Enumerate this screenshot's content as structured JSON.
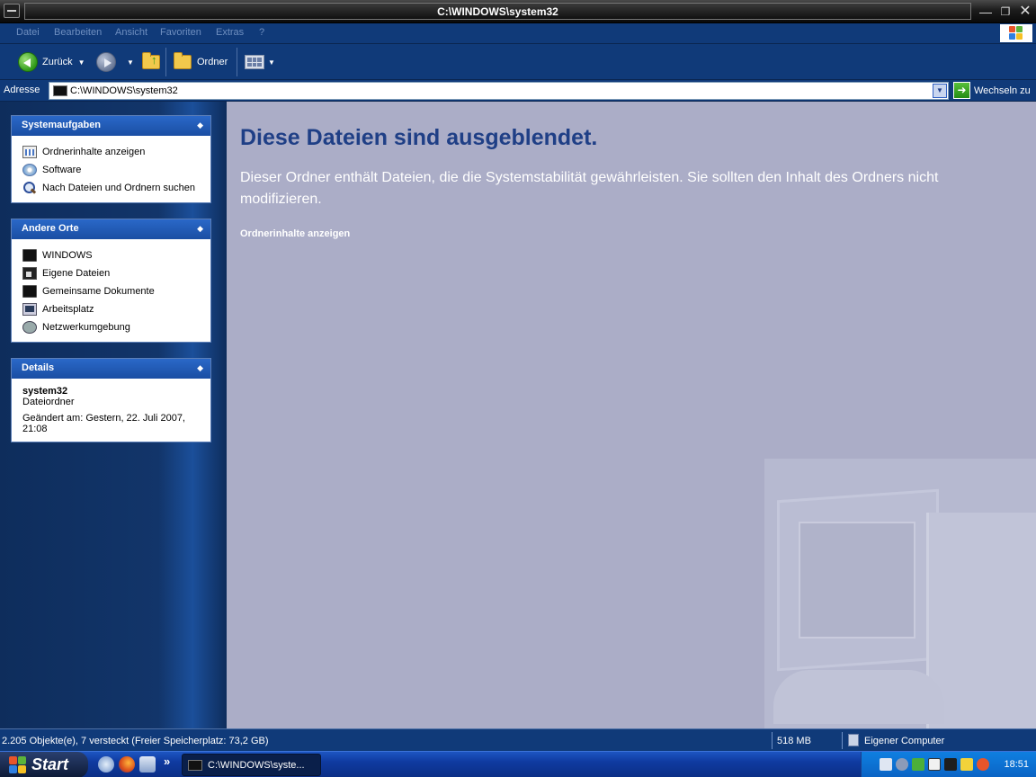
{
  "window": {
    "title": "C:\\WINDOWS\\system32"
  },
  "menu": {
    "items": [
      "Datei",
      "Bearbeiten",
      "Ansicht",
      "Favoriten",
      "Extras",
      "?"
    ]
  },
  "toolbar": {
    "back_label": "Zurück",
    "folders_label": "Ordner"
  },
  "address": {
    "label": "Adresse",
    "value": "C:\\WINDOWS\\system32",
    "go_label": "Wechseln zu"
  },
  "tasks": {
    "title": "Systemaufgaben",
    "items": [
      "Ordnerinhalte anzeigen",
      "Software",
      "Nach Dateien und Ordnern suchen"
    ]
  },
  "places": {
    "title": "Andere Orte",
    "items": [
      "WINDOWS",
      "Eigene Dateien",
      "Gemeinsame Dokumente",
      "Arbeitsplatz",
      "Netzwerkumgebung"
    ]
  },
  "details": {
    "title": "Details",
    "name": "system32",
    "type": "Dateiordner",
    "modified": "Geändert am: Gestern, 22. Juli 2007, 21:08"
  },
  "content": {
    "heading": "Diese Dateien sind ausgeblendet.",
    "message": "Dieser Ordner enthält Dateien, die die Systemstabilität gewährleisten. Sie sollten den Inhalt des Ordners nicht modifizieren.",
    "link": "Ordnerinhalte anzeigen"
  },
  "status": {
    "objects": "2.205 Objekte(e), 7 versteckt (Freier Speicherplatz: 73,2 GB)",
    "size": "518 MB",
    "zone": "Eigener Computer"
  },
  "taskbar": {
    "start_label": "Start",
    "task_label": "C:\\WINDOWS\\syste...",
    "clock": "18:51"
  },
  "colors": {
    "accent": "#103a79",
    "content_bg": "#abadc7",
    "heading": "#1f3f86"
  }
}
